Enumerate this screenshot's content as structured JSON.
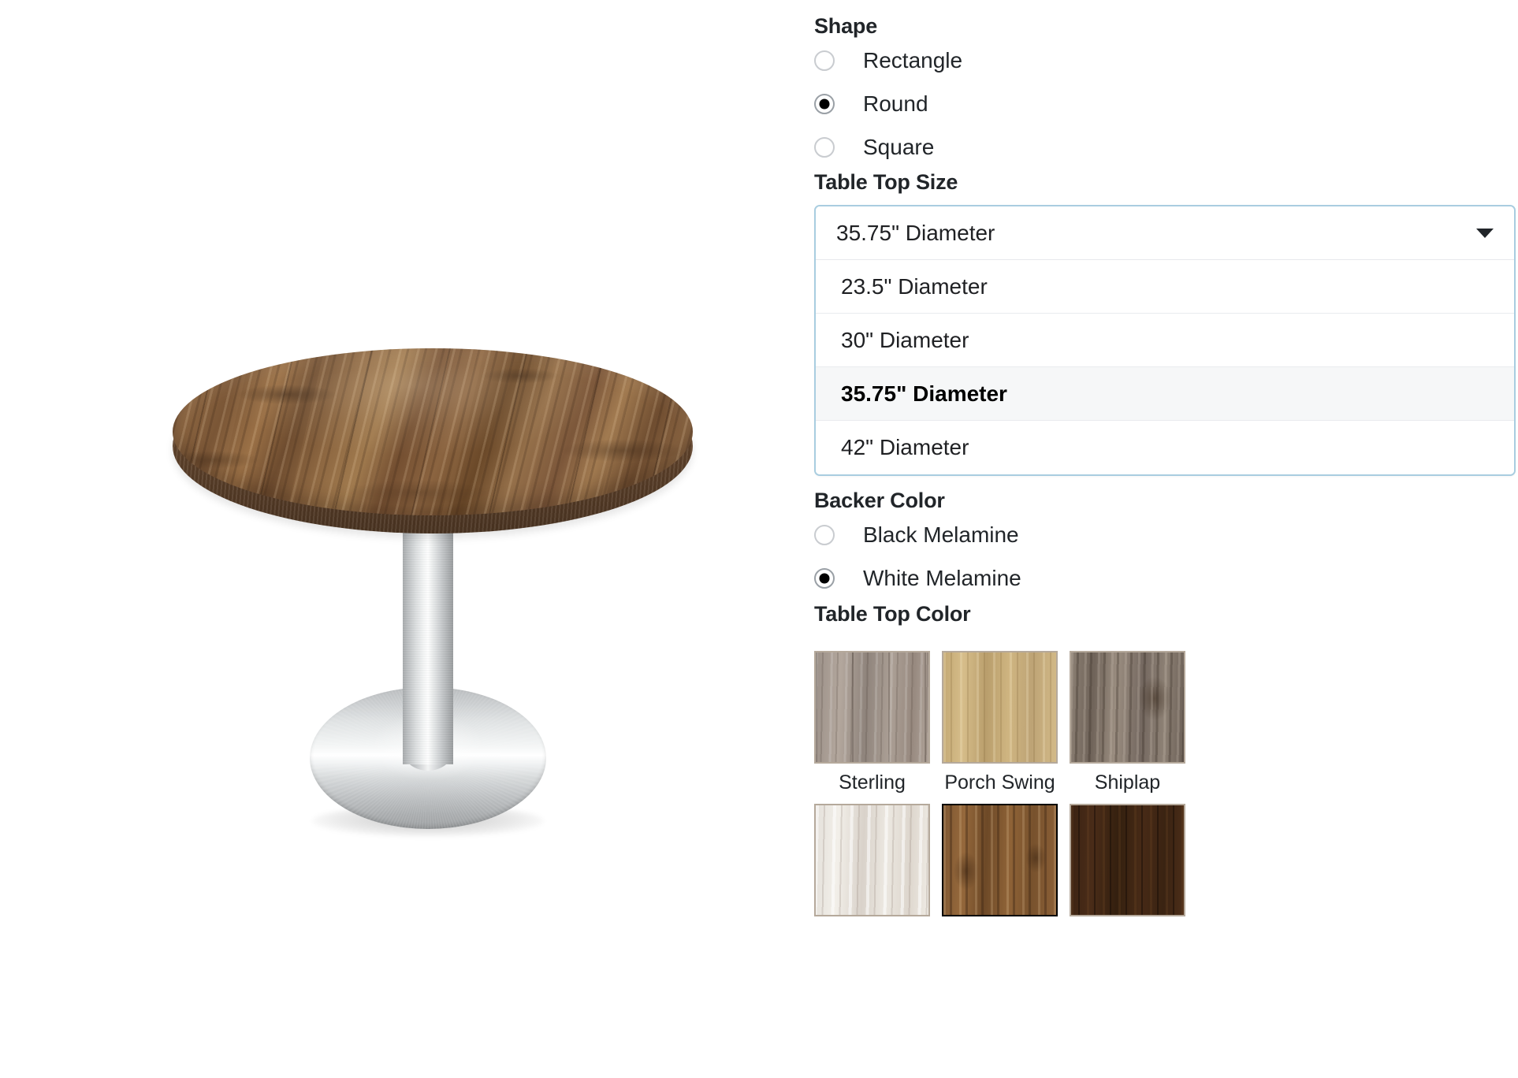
{
  "preview": {
    "product_alt": "Round wood-top pedestal table with brushed stainless base",
    "table_top_finish": "Rustic wood",
    "base_finish": "Brushed stainless steel",
    "shape_shown": "Round"
  },
  "config": {
    "shape": {
      "title": "Shape",
      "options": [
        {
          "label": "Rectangle",
          "selected": false
        },
        {
          "label": "Round",
          "selected": true
        },
        {
          "label": "Square",
          "selected": false
        }
      ]
    },
    "table_top_size": {
      "title": "Table Top Size",
      "selected_value": "35.75\" Diameter",
      "expanded": true,
      "caret_icon": "chevron-down-icon",
      "options": [
        {
          "label": "23.5\" Diameter",
          "selected": false
        },
        {
          "label": "30\" Diameter",
          "selected": false
        },
        {
          "label": "35.75\" Diameter",
          "selected": true
        },
        {
          "label": "42\" Diameter",
          "selected": false
        }
      ]
    },
    "backer_color": {
      "title": "Backer Color",
      "options": [
        {
          "label": "Black Melamine",
          "selected": false
        },
        {
          "label": "White Melamine",
          "selected": true
        }
      ]
    },
    "table_top_color": {
      "title": "Table Top Color",
      "swatches": [
        {
          "label": "Sterling",
          "selected": false,
          "tex": "tex-sterling",
          "swatch_color": "#9b9088"
        },
        {
          "label": "Porch Swing",
          "selected": false,
          "tex": "tex-porch",
          "swatch_color": "#c8ad78"
        },
        {
          "label": "Shiplap",
          "selected": false,
          "tex": "tex-shiplap",
          "swatch_color": "#7f7368"
        },
        {
          "label": "",
          "selected": false,
          "tex": "tex-whitewash",
          "swatch_color": "#e4e0da"
        },
        {
          "label": "",
          "selected": true,
          "tex": "tex-rustic",
          "swatch_color": "#805833"
        },
        {
          "label": "",
          "selected": false,
          "tex": "tex-espresso",
          "swatch_color": "#3d2514"
        }
      ]
    }
  },
  "colors": {
    "focus_border": "#a9cde0",
    "selected_row_bg": "#f6f7f8",
    "text": "#212529",
    "radio_border": "#c9ccd0",
    "selected_swatch_border": "#000000"
  }
}
